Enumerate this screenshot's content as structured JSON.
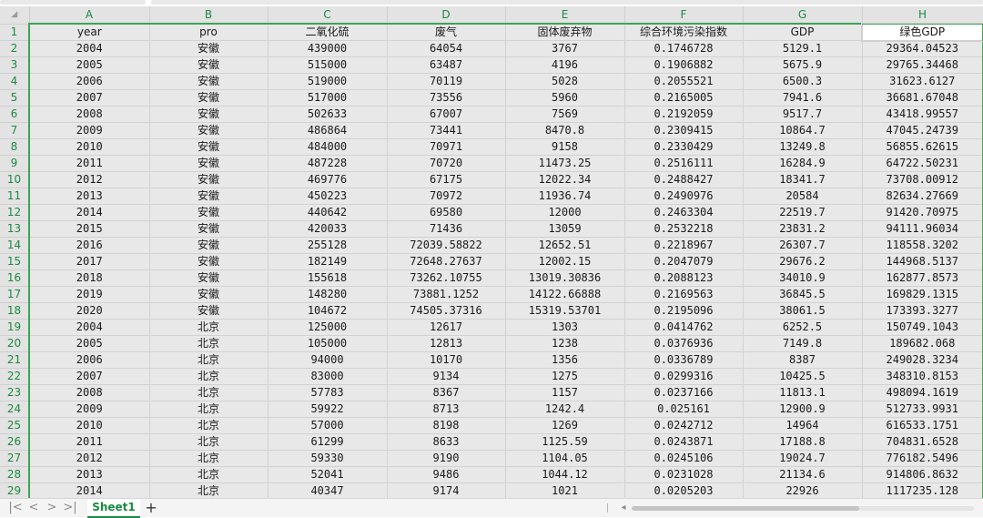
{
  "columns": [
    "A",
    "B",
    "C",
    "D",
    "E",
    "F",
    "G",
    "H"
  ],
  "header_row": {
    "row_number": "1",
    "cells": [
      "year",
      "pro",
      "二氧化硫",
      "废气",
      "固体废弃物",
      "综合环境污染指数",
      "GDP",
      "绿色GDP"
    ]
  },
  "rows": [
    {
      "n": "2",
      "cells": [
        "2004",
        "安徽",
        "439000",
        "64054",
        "3767",
        "0.1746728",
        "5129.1",
        "29364.04523"
      ]
    },
    {
      "n": "3",
      "cells": [
        "2005",
        "安徽",
        "515000",
        "63487",
        "4196",
        "0.1906882",
        "5675.9",
        "29765.34468"
      ]
    },
    {
      "n": "4",
      "cells": [
        "2006",
        "安徽",
        "519000",
        "70119",
        "5028",
        "0.2055521",
        "6500.3",
        "31623.6127"
      ]
    },
    {
      "n": "5",
      "cells": [
        "2007",
        "安徽",
        "517000",
        "73556",
        "5960",
        "0.2165005",
        "7941.6",
        "36681.67048"
      ]
    },
    {
      "n": "6",
      "cells": [
        "2008",
        "安徽",
        "502633",
        "67007",
        "7569",
        "0.2192059",
        "9517.7",
        "43418.99557"
      ]
    },
    {
      "n": "7",
      "cells": [
        "2009",
        "安徽",
        "486864",
        "73441",
        "8470.8",
        "0.2309415",
        "10864.7",
        "47045.24739"
      ]
    },
    {
      "n": "8",
      "cells": [
        "2010",
        "安徽",
        "484000",
        "70971",
        "9158",
        "0.2330429",
        "13249.8",
        "56855.62615"
      ]
    },
    {
      "n": "9",
      "cells": [
        "2011",
        "安徽",
        "487228",
        "70720",
        "11473.25",
        "0.2516111",
        "16284.9",
        "64722.50231"
      ]
    },
    {
      "n": "10",
      "cells": [
        "2012",
        "安徽",
        "469776",
        "67175",
        "12022.34",
        "0.2488427",
        "18341.7",
        "73708.00912"
      ]
    },
    {
      "n": "11",
      "cells": [
        "2013",
        "安徽",
        "450223",
        "70972",
        "11936.74",
        "0.2490976",
        "20584",
        "82634.27669"
      ]
    },
    {
      "n": "12",
      "cells": [
        "2014",
        "安徽",
        "440642",
        "69580",
        "12000",
        "0.2463304",
        "22519.7",
        "91420.70975"
      ]
    },
    {
      "n": "13",
      "cells": [
        "2015",
        "安徽",
        "420033",
        "71436",
        "13059",
        "0.2532218",
        "23831.2",
        "94111.96034"
      ]
    },
    {
      "n": "14",
      "cells": [
        "2016",
        "安徽",
        "255128",
        "72039.58822",
        "12652.51",
        "0.2218967",
        "26307.7",
        "118558.3202"
      ]
    },
    {
      "n": "15",
      "cells": [
        "2017",
        "安徽",
        "182149",
        "72648.27637",
        "12002.15",
        "0.2047079",
        "29676.2",
        "144968.5137"
      ]
    },
    {
      "n": "16",
      "cells": [
        "2018",
        "安徽",
        "155618",
        "73262.10755",
        "13019.30836",
        "0.2088123",
        "34010.9",
        "162877.8573"
      ]
    },
    {
      "n": "17",
      "cells": [
        "2019",
        "安徽",
        "148280",
        "73881.1252",
        "14122.66888",
        "0.2169563",
        "36845.5",
        "169829.1315"
      ]
    },
    {
      "n": "18",
      "cells": [
        "2020",
        "安徽",
        "104672",
        "74505.37316",
        "15319.53701",
        "0.2195096",
        "38061.5",
        "173393.3277"
      ]
    },
    {
      "n": "19",
      "cells": [
        "2004",
        "北京",
        "125000",
        "12617",
        "1303",
        "0.0414762",
        "6252.5",
        "150749.1043"
      ]
    },
    {
      "n": "20",
      "cells": [
        "2005",
        "北京",
        "105000",
        "12813",
        "1238",
        "0.0376936",
        "7149.8",
        "189682.068"
      ]
    },
    {
      "n": "21",
      "cells": [
        "2006",
        "北京",
        "94000",
        "10170",
        "1356",
        "0.0336789",
        "8387",
        "249028.3234"
      ]
    },
    {
      "n": "22",
      "cells": [
        "2007",
        "北京",
        "83000",
        "9134",
        "1275",
        "0.0299316",
        "10425.5",
        "348310.8153"
      ]
    },
    {
      "n": "23",
      "cells": [
        "2008",
        "北京",
        "57783",
        "8367",
        "1157",
        "0.0237166",
        "11813.1",
        "498094.1619"
      ]
    },
    {
      "n": "24",
      "cells": [
        "2009",
        "北京",
        "59922",
        "8713",
        "1242.4",
        "0.025161",
        "12900.9",
        "512733.9931"
      ]
    },
    {
      "n": "25",
      "cells": [
        "2010",
        "北京",
        "57000",
        "8198",
        "1269",
        "0.0242712",
        "14964",
        "616533.1751"
      ]
    },
    {
      "n": "26",
      "cells": [
        "2011",
        "北京",
        "61299",
        "8633",
        "1125.59",
        "0.0243871",
        "17188.8",
        "704831.6528"
      ]
    },
    {
      "n": "27",
      "cells": [
        "2012",
        "北京",
        "59330",
        "9190",
        "1104.05",
        "0.0245106",
        "19024.7",
        "776182.5496"
      ]
    },
    {
      "n": "28",
      "cells": [
        "2013",
        "北京",
        "52041",
        "9486",
        "1044.12",
        "0.0231028",
        "21134.6",
        "914806.8632"
      ]
    },
    {
      "n": "29",
      "cells": [
        "2014",
        "北京",
        "40347",
        "9174",
        "1021",
        "0.0205203",
        "22926",
        "1117235.128"
      ]
    }
  ],
  "tabbar": {
    "nav_first": "|<",
    "nav_prev": "<",
    "nav_next": ">",
    "nav_last": ">|",
    "sheet_tab": "Sheet1",
    "add_sheet": "+",
    "scroll_left": "◂"
  },
  "corner_icon": "select-all-triangle-icon"
}
